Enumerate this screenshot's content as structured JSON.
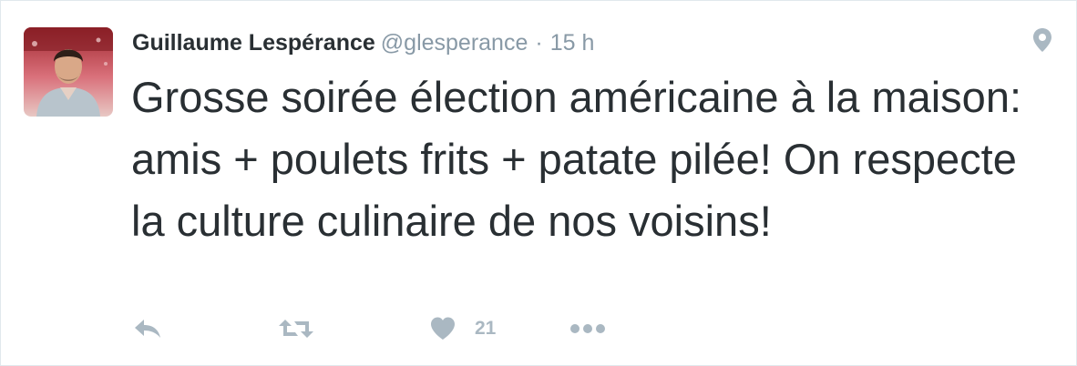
{
  "tweet": {
    "author": {
      "display_name": "Guillaume Lespérance",
      "screen_name": "@glesperance",
      "avatar_icon": "profile-photo"
    },
    "separator": "·",
    "timestamp": "15 h",
    "text": "Grosse soirée élection américaine à la maison: amis + poulets frits + patate pilée! On respecte la culture culinaire de nos voisins!",
    "location_icon": "location-pin-icon"
  },
  "actions": {
    "reply_icon": "reply-icon",
    "retweet_icon": "retweet-icon",
    "like_icon": "heart-icon",
    "like_count": "21",
    "more_icon": "ellipsis-icon"
  },
  "colors": {
    "text_primary": "#292f33",
    "text_secondary": "#8899a6",
    "icon_gray": "#aab8c2",
    "border": "#e1e8ed"
  }
}
